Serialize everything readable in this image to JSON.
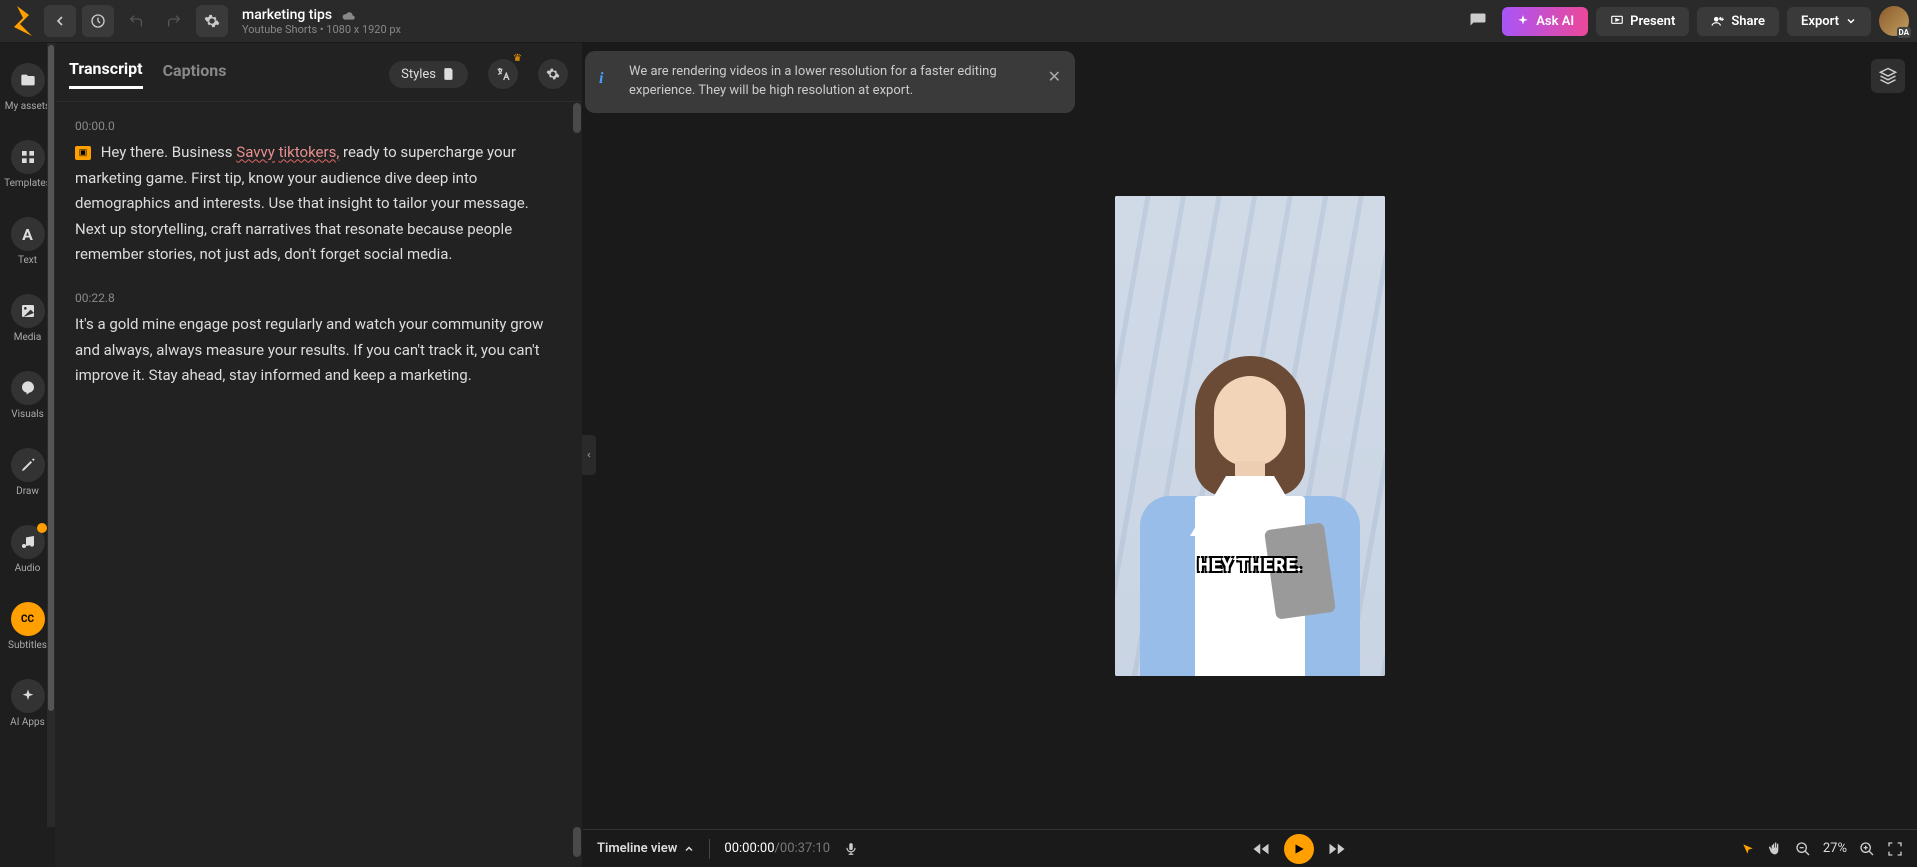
{
  "header": {
    "title": "marketing tips",
    "subtitle": "Youtube Shorts • 1080 x 1920 px"
  },
  "topActions": {
    "askAI": "Ask AI",
    "present": "Present",
    "share": "Share",
    "export": "Export"
  },
  "rail": [
    {
      "label": "My assets"
    },
    {
      "label": "Templates"
    },
    {
      "label": "Text"
    },
    {
      "label": "Media"
    },
    {
      "label": "Visuals"
    },
    {
      "label": "Draw"
    },
    {
      "label": "Audio"
    },
    {
      "label": "Subtitles"
    },
    {
      "label": "AI Apps"
    }
  ],
  "middle": {
    "tabTranscript": "Transcript",
    "tabCaptions": "Captions",
    "stylesLabel": "Styles"
  },
  "transcript": [
    {
      "time": "00:00.0",
      "pre": "Hey there. Business",
      "err1": "Savvy",
      "err2": "tiktokers,",
      "post": "ready to supercharge your marketing game. First tip, know your audience dive deep into demographics and interests. Use that insight to tailor your message. Next up storytelling, craft narratives that resonate because people remember stories, not just ads, don't forget social media."
    },
    {
      "time": "00:22.8",
      "text": "It's a gold mine engage post regularly and watch your community grow and always, always measure your results. If you can't track it, you can't improve it. Stay ahead, stay informed and keep a marketing."
    }
  ],
  "toast": "We are rendering videos in a lower resolution for a faster editing experience. They will be high resolution at export.",
  "captionOverlay": "HEY THERE.",
  "bottom": {
    "timelineLabel": "Timeline view",
    "current": "00:00:00",
    "duration": "00:37:10",
    "zoom": "27%"
  }
}
